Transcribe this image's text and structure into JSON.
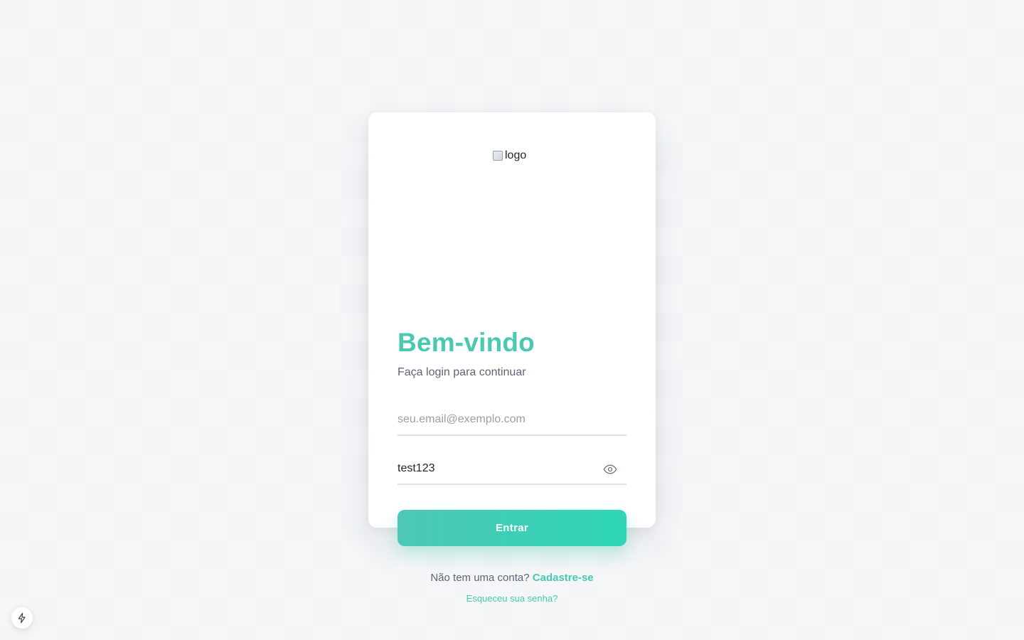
{
  "logo": {
    "alt_text": "logo"
  },
  "login": {
    "title": "Bem-vindo",
    "subtitle": "Faça login para continuar",
    "email": {
      "placeholder": "seu.email@exemplo.com",
      "value": ""
    },
    "password": {
      "value": "test123"
    },
    "submit_label": "Entrar",
    "signup_prompt": "Não tem uma conta?",
    "signup_link": "Cadastre-se",
    "forgot_link": "Esqueceu sua senha?"
  },
  "icons": {
    "password_toggle": "eye-icon",
    "dev_badge": "lightning-icon"
  },
  "colors": {
    "accent": "#48c9b0",
    "button_gradient_start": "#4ec7b5",
    "button_gradient_end": "#2ed5b6",
    "text_muted": "#5d6571",
    "background": "#f3f5f7"
  }
}
